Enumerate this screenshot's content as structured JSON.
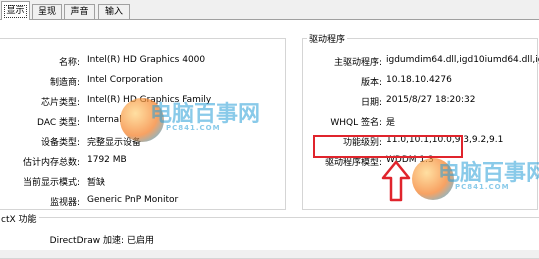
{
  "tabs": [
    {
      "label": "显示",
      "active": true
    },
    {
      "label": "呈现",
      "active": false
    },
    {
      "label": "声音",
      "active": false
    },
    {
      "label": "输入",
      "active": false
    }
  ],
  "device": {
    "rows": [
      {
        "label": "名称:",
        "value": "Intel(R) HD Graphics 4000"
      },
      {
        "label": "制造商:",
        "value": "Intel Corporation"
      },
      {
        "label": "芯片类型:",
        "value": "Intel(R) HD Graphics Family"
      },
      {
        "label": "DAC 类型:",
        "value": "Internal"
      },
      {
        "label": "设备类型:",
        "value": "完整显示设备"
      },
      {
        "label": "估计内存总数:",
        "value": "1792 MB"
      },
      {
        "label": "当前显示模式:",
        "value": "暂缺"
      },
      {
        "label": "监视器:",
        "value": "Generic PnP Monitor"
      }
    ]
  },
  "driver": {
    "title": "驱动程序",
    "rows": [
      {
        "label": "主驱动程序:",
        "value": "igdumdim64.dll,igd10iumd64.dll,igd"
      },
      {
        "label": "版本:",
        "value": "10.18.10.4276"
      },
      {
        "label": "日期:",
        "value": "2015/8/27 18:20:32"
      },
      {
        "label": "WHQL 签名:",
        "value": "是"
      },
      {
        "label": "功能级别:",
        "value": "11.0,10.1,10.0,9.3,9.2,9.1"
      },
      {
        "label": "驱动程序模型:",
        "value": "WDDM 1.3"
      }
    ]
  },
  "directx": {
    "title": "ctX 功能",
    "rows": [
      {
        "label": "DirectDraw 加速:",
        "value": "已启用"
      }
    ]
  },
  "watermarks": [
    {
      "cn": "电脑百事网",
      "en": "PC841.COM"
    },
    {
      "cn": "电脑百事网",
      "en": "PC841.COM"
    }
  ],
  "colors": {
    "highlight": "#e0242c",
    "watermark": "#2a9fd8",
    "watermark_accent": "#f47a20"
  }
}
